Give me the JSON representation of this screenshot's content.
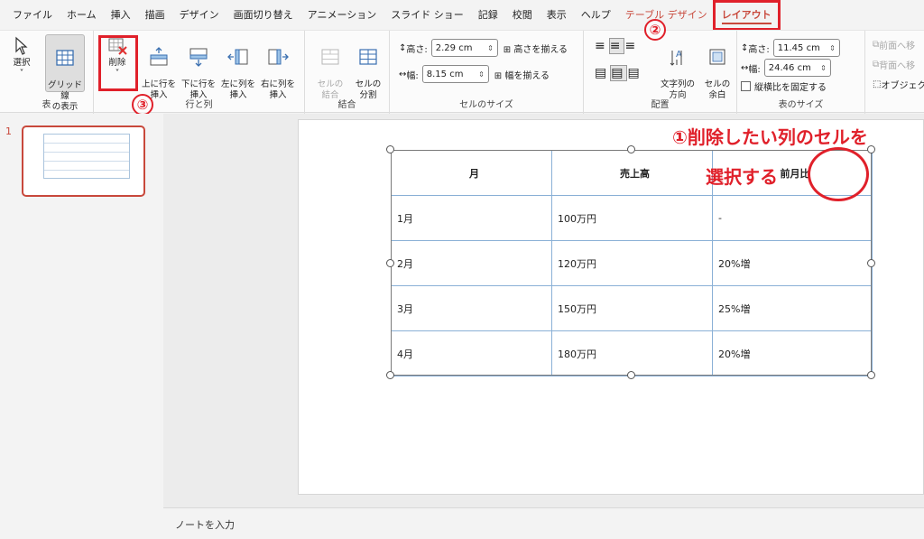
{
  "tabs": [
    "ファイル",
    "ホーム",
    "挿入",
    "描画",
    "デザイン",
    "画面切り替え",
    "アニメーション",
    "スライド ショー",
    "記録",
    "校閲",
    "表示",
    "ヘルプ",
    "テーブル デザイン",
    "レイアウト"
  ],
  "ribbon": {
    "table_group": {
      "label": "表",
      "select": "選択",
      "gridlines": "グリッド線\nの表示"
    },
    "rows_cols_group": {
      "label": "行と列",
      "delete": "削除",
      "insert_above": "上に行を\n挿入",
      "insert_below": "下に行を\n挿入",
      "insert_left": "左に列を\n挿入",
      "insert_right": "右に列を\n挿入"
    },
    "merge_group": {
      "label": "結合",
      "merge": "セルの\n結合",
      "split": "セルの\n分割"
    },
    "cell_size_group": {
      "label": "セルのサイズ",
      "height_label": "高さ:",
      "height_value": "2.29 cm",
      "width_label": "幅:",
      "width_value": "8.15 cm",
      "distribute_rows": "高さを揃える",
      "distribute_cols": "幅を揃える"
    },
    "alignment_group": {
      "label": "配置",
      "text_direction": "文字列の\n方向",
      "cell_margins": "セルの\n余白"
    },
    "table_size_group": {
      "label": "表のサイズ",
      "height_label": "高さ:",
      "height_value": "11.45 cm",
      "width_label": "幅:",
      "width_value": "24.46 cm",
      "lock_ratio": "縦横比を固定する"
    },
    "arrange_group": {
      "bring_forward": "前面へ移",
      "send_backward": "背面へ移",
      "selection_pane": "オブジェク"
    }
  },
  "slides": {
    "number": "1"
  },
  "table": {
    "headers": [
      "月",
      "売上高",
      "前月比"
    ],
    "rows": [
      [
        "1月",
        "100万円",
        "-"
      ],
      [
        "2月",
        "120万円",
        "20%増"
      ],
      [
        "3月",
        "150万円",
        "25%増"
      ],
      [
        "4月",
        "180万円",
        "20%増"
      ]
    ]
  },
  "annotations": {
    "step1_line1": "①削除したい列のセルを",
    "step1_line2": "選択する",
    "step2": "②",
    "step3": "③",
    "color": "#e0202a"
  },
  "notes_placeholder": "ノートを入力"
}
